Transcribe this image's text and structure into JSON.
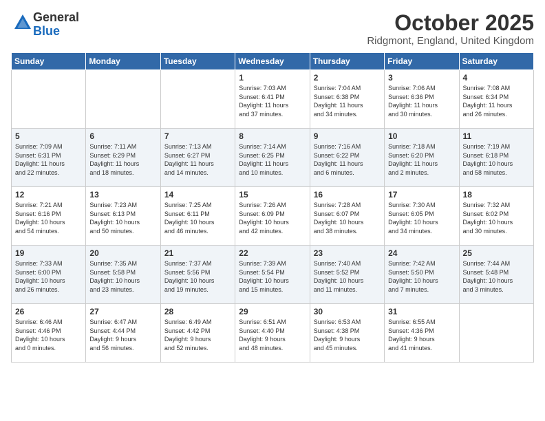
{
  "header": {
    "logo_general": "General",
    "logo_blue": "Blue",
    "month_title": "October 2025",
    "location": "Ridgmont, England, United Kingdom"
  },
  "days_of_week": [
    "Sunday",
    "Monday",
    "Tuesday",
    "Wednesday",
    "Thursday",
    "Friday",
    "Saturday"
  ],
  "weeks": [
    [
      {
        "day": "",
        "info": ""
      },
      {
        "day": "",
        "info": ""
      },
      {
        "day": "",
        "info": ""
      },
      {
        "day": "1",
        "info": "Sunrise: 7:03 AM\nSunset: 6:41 PM\nDaylight: 11 hours\nand 37 minutes."
      },
      {
        "day": "2",
        "info": "Sunrise: 7:04 AM\nSunset: 6:38 PM\nDaylight: 11 hours\nand 34 minutes."
      },
      {
        "day": "3",
        "info": "Sunrise: 7:06 AM\nSunset: 6:36 PM\nDaylight: 11 hours\nand 30 minutes."
      },
      {
        "day": "4",
        "info": "Sunrise: 7:08 AM\nSunset: 6:34 PM\nDaylight: 11 hours\nand 26 minutes."
      }
    ],
    [
      {
        "day": "5",
        "info": "Sunrise: 7:09 AM\nSunset: 6:31 PM\nDaylight: 11 hours\nand 22 minutes."
      },
      {
        "day": "6",
        "info": "Sunrise: 7:11 AM\nSunset: 6:29 PM\nDaylight: 11 hours\nand 18 minutes."
      },
      {
        "day": "7",
        "info": "Sunrise: 7:13 AM\nSunset: 6:27 PM\nDaylight: 11 hours\nand 14 minutes."
      },
      {
        "day": "8",
        "info": "Sunrise: 7:14 AM\nSunset: 6:25 PM\nDaylight: 11 hours\nand 10 minutes."
      },
      {
        "day": "9",
        "info": "Sunrise: 7:16 AM\nSunset: 6:22 PM\nDaylight: 11 hours\nand 6 minutes."
      },
      {
        "day": "10",
        "info": "Sunrise: 7:18 AM\nSunset: 6:20 PM\nDaylight: 11 hours\nand 2 minutes."
      },
      {
        "day": "11",
        "info": "Sunrise: 7:19 AM\nSunset: 6:18 PM\nDaylight: 10 hours\nand 58 minutes."
      }
    ],
    [
      {
        "day": "12",
        "info": "Sunrise: 7:21 AM\nSunset: 6:16 PM\nDaylight: 10 hours\nand 54 minutes."
      },
      {
        "day": "13",
        "info": "Sunrise: 7:23 AM\nSunset: 6:13 PM\nDaylight: 10 hours\nand 50 minutes."
      },
      {
        "day": "14",
        "info": "Sunrise: 7:25 AM\nSunset: 6:11 PM\nDaylight: 10 hours\nand 46 minutes."
      },
      {
        "day": "15",
        "info": "Sunrise: 7:26 AM\nSunset: 6:09 PM\nDaylight: 10 hours\nand 42 minutes."
      },
      {
        "day": "16",
        "info": "Sunrise: 7:28 AM\nSunset: 6:07 PM\nDaylight: 10 hours\nand 38 minutes."
      },
      {
        "day": "17",
        "info": "Sunrise: 7:30 AM\nSunset: 6:05 PM\nDaylight: 10 hours\nand 34 minutes."
      },
      {
        "day": "18",
        "info": "Sunrise: 7:32 AM\nSunset: 6:02 PM\nDaylight: 10 hours\nand 30 minutes."
      }
    ],
    [
      {
        "day": "19",
        "info": "Sunrise: 7:33 AM\nSunset: 6:00 PM\nDaylight: 10 hours\nand 26 minutes."
      },
      {
        "day": "20",
        "info": "Sunrise: 7:35 AM\nSunset: 5:58 PM\nDaylight: 10 hours\nand 23 minutes."
      },
      {
        "day": "21",
        "info": "Sunrise: 7:37 AM\nSunset: 5:56 PM\nDaylight: 10 hours\nand 19 minutes."
      },
      {
        "day": "22",
        "info": "Sunrise: 7:39 AM\nSunset: 5:54 PM\nDaylight: 10 hours\nand 15 minutes."
      },
      {
        "day": "23",
        "info": "Sunrise: 7:40 AM\nSunset: 5:52 PM\nDaylight: 10 hours\nand 11 minutes."
      },
      {
        "day": "24",
        "info": "Sunrise: 7:42 AM\nSunset: 5:50 PM\nDaylight: 10 hours\nand 7 minutes."
      },
      {
        "day": "25",
        "info": "Sunrise: 7:44 AM\nSunset: 5:48 PM\nDaylight: 10 hours\nand 3 minutes."
      }
    ],
    [
      {
        "day": "26",
        "info": "Sunrise: 6:46 AM\nSunset: 4:46 PM\nDaylight: 10 hours\nand 0 minutes."
      },
      {
        "day": "27",
        "info": "Sunrise: 6:47 AM\nSunset: 4:44 PM\nDaylight: 9 hours\nand 56 minutes."
      },
      {
        "day": "28",
        "info": "Sunrise: 6:49 AM\nSunset: 4:42 PM\nDaylight: 9 hours\nand 52 minutes."
      },
      {
        "day": "29",
        "info": "Sunrise: 6:51 AM\nSunset: 4:40 PM\nDaylight: 9 hours\nand 48 minutes."
      },
      {
        "day": "30",
        "info": "Sunrise: 6:53 AM\nSunset: 4:38 PM\nDaylight: 9 hours\nand 45 minutes."
      },
      {
        "day": "31",
        "info": "Sunrise: 6:55 AM\nSunset: 4:36 PM\nDaylight: 9 hours\nand 41 minutes."
      },
      {
        "day": "",
        "info": ""
      }
    ]
  ]
}
